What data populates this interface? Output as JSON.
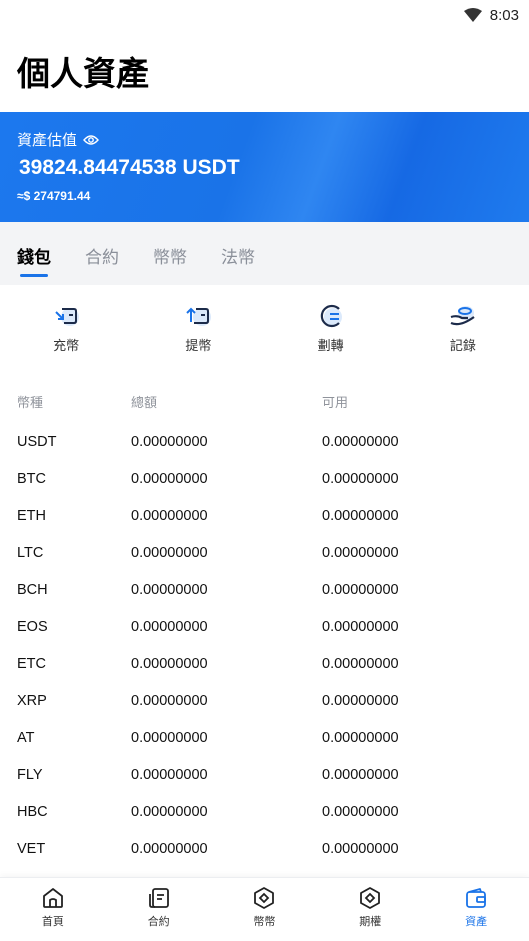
{
  "status_bar": {
    "time": "8:03"
  },
  "page_title": "個人資產",
  "banner": {
    "label": "資產估值",
    "amount": "39824.84474538 USDT",
    "fiat": "≈$ 274791.44"
  },
  "tabs": [
    {
      "label": "錢包",
      "active": true
    },
    {
      "label": "合約",
      "active": false
    },
    {
      "label": "幣幣",
      "active": false
    },
    {
      "label": "法幣",
      "active": false
    }
  ],
  "actions": [
    {
      "label": "充幣",
      "icon": "deposit-icon"
    },
    {
      "label": "提幣",
      "icon": "withdraw-icon"
    },
    {
      "label": "劃轉",
      "icon": "transfer-icon"
    },
    {
      "label": "記錄",
      "icon": "records-icon"
    }
  ],
  "table": {
    "headers": [
      "幣種",
      "總額",
      "可用"
    ],
    "rows": [
      [
        "USDT",
        "0.00000000",
        "0.00000000"
      ],
      [
        "BTC",
        "0.00000000",
        "0.00000000"
      ],
      [
        "ETH",
        "0.00000000",
        "0.00000000"
      ],
      [
        "LTC",
        "0.00000000",
        "0.00000000"
      ],
      [
        "BCH",
        "0.00000000",
        "0.00000000"
      ],
      [
        "EOS",
        "0.00000000",
        "0.00000000"
      ],
      [
        "ETC",
        "0.00000000",
        "0.00000000"
      ],
      [
        "XRP",
        "0.00000000",
        "0.00000000"
      ],
      [
        "AT",
        "0.00000000",
        "0.00000000"
      ],
      [
        "FLY",
        "0.00000000",
        "0.00000000"
      ],
      [
        "HBC",
        "0.00000000",
        "0.00000000"
      ],
      [
        "VET",
        "0.00000000",
        "0.00000000"
      ]
    ]
  },
  "bottom_nav": [
    {
      "label": "首頁",
      "icon": "home-icon",
      "active": false
    },
    {
      "label": "合約",
      "icon": "contract-icon",
      "active": false
    },
    {
      "label": "幣幣",
      "icon": "coin-icon",
      "active": false
    },
    {
      "label": "期權",
      "icon": "options-icon",
      "active": false
    },
    {
      "label": "資產",
      "icon": "wallet-icon",
      "active": true
    }
  ],
  "colors": {
    "accent": "#1a73e8",
    "banner": "#1a73e8"
  }
}
